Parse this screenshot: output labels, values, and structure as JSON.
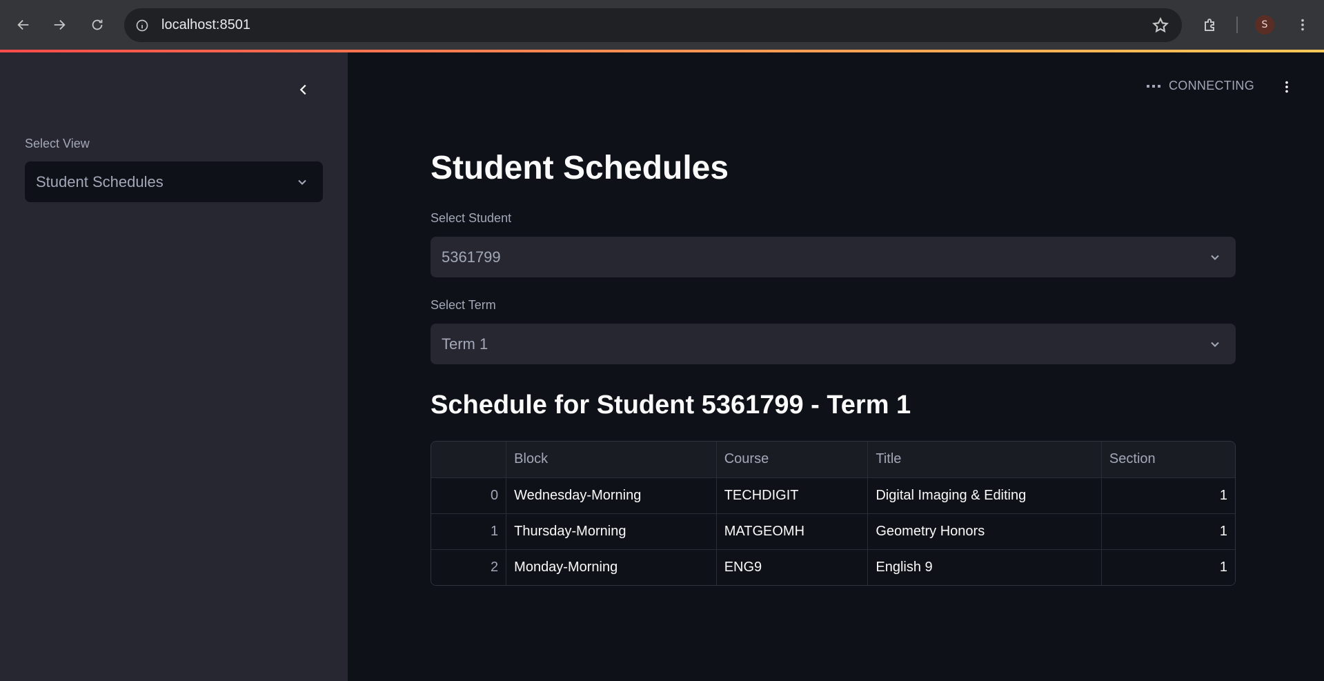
{
  "browser": {
    "url": "localhost:8501",
    "profile_initial": "S",
    "icons": [
      "back-arrow-icon",
      "forward-arrow-icon",
      "reload-icon",
      "site-info-icon",
      "bookmark-star-icon",
      "extensions-icon",
      "chrome-menu-icon"
    ]
  },
  "sidebar": {
    "select_label": "Select View",
    "select_value": "Student Schedules"
  },
  "header": {
    "status_text": "CONNECTING"
  },
  "main": {
    "title": "Student Schedules",
    "student_label": "Select Student",
    "student_value": "5361799",
    "term_label": "Select Term",
    "term_value": "Term 1",
    "schedule_title": "Schedule for Student 5361799 - Term 1"
  },
  "table": {
    "columns": [
      "",
      "Block",
      "Course",
      "Title",
      "Section"
    ],
    "rows": [
      {
        "index": "0",
        "block": "Wednesday-Morning",
        "course": "TECHDIGIT",
        "title": "Digital Imaging & Editing",
        "section": "1"
      },
      {
        "index": "1",
        "block": "Thursday-Morning",
        "course": "MATGEOMH",
        "title": "Geometry Honors",
        "section": "1"
      },
      {
        "index": "2",
        "block": "Monday-Morning",
        "course": "ENG9",
        "title": "English 9",
        "section": "1"
      }
    ]
  },
  "colors": {
    "sidebar_bg": "#262730",
    "main_bg": "#0e1117",
    "accent_gradient_start": "#ff4b4b",
    "accent_gradient_end": "#ffc957"
  }
}
